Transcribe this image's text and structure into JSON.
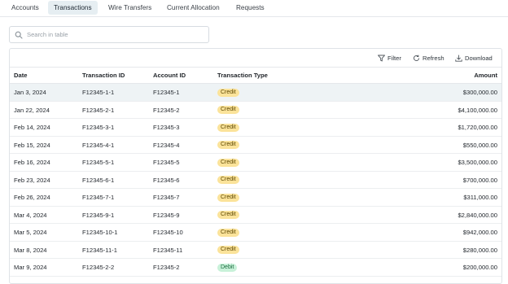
{
  "tabs": [
    {
      "label": "Accounts",
      "active": false
    },
    {
      "label": "Transactions",
      "active": true
    },
    {
      "label": "Wire Transfers",
      "active": false
    },
    {
      "label": "Current Allocation",
      "active": false
    },
    {
      "label": "Requests",
      "active": false
    }
  ],
  "search": {
    "placeholder": "Search in table",
    "icon": "search-icon"
  },
  "toolbar": {
    "filter_label": "Filter",
    "refresh_label": "Refresh",
    "download_label": "Download"
  },
  "columns": {
    "date": "Date",
    "transaction_id": "Transaction ID",
    "account_id": "Account ID",
    "transaction_type": "Transaction Type",
    "amount": "Amount"
  },
  "type_colors": {
    "Credit": {
      "bg": "#fbe39a",
      "fg": "#5c4700"
    },
    "Debit": {
      "bg": "#c8f1d9",
      "fg": "#1d6b3e"
    }
  },
  "rows": [
    {
      "date": "Jan 3, 2024",
      "transaction_id": "F12345-1-1",
      "account_id": "F12345-1",
      "type": "Credit",
      "amount": "$300,000.00"
    },
    {
      "date": "Jan 22, 2024",
      "transaction_id": "F12345-2-1",
      "account_id": "F12345-2",
      "type": "Credit",
      "amount": "$4,100,000.00"
    },
    {
      "date": "Feb 14, 2024",
      "transaction_id": "F12345-3-1",
      "account_id": "F12345-3",
      "type": "Credit",
      "amount": "$1,720,000.00"
    },
    {
      "date": "Feb 15, 2024",
      "transaction_id": "F12345-4-1",
      "account_id": "F12345-4",
      "type": "Credit",
      "amount": "$550,000.00"
    },
    {
      "date": "Feb 16, 2024",
      "transaction_id": "F12345-5-1",
      "account_id": "F12345-5",
      "type": "Credit",
      "amount": "$3,500,000.00"
    },
    {
      "date": "Feb 23, 2024",
      "transaction_id": "F12345-6-1",
      "account_id": "F12345-6",
      "type": "Credit",
      "amount": "$700,000.00"
    },
    {
      "date": "Feb 26, 2024",
      "transaction_id": "F12345-7-1",
      "account_id": "F12345-7",
      "type": "Credit",
      "amount": "$311,000.00"
    },
    {
      "date": "Mar 4, 2024",
      "transaction_id": "F12345-9-1",
      "account_id": "F12345-9",
      "type": "Credit",
      "amount": "$2,840,000.00"
    },
    {
      "date": "Mar 5, 2024",
      "transaction_id": "F12345-10-1",
      "account_id": "F12345-10",
      "type": "Credit",
      "amount": "$942,000.00"
    },
    {
      "date": "Mar 8, 2024",
      "transaction_id": "F12345-11-1",
      "account_id": "F12345-11",
      "type": "Credit",
      "amount": "$280,000.00"
    },
    {
      "date": "Mar 9, 2024",
      "transaction_id": "F12345-2-2",
      "account_id": "F12345-2",
      "type": "Debit",
      "amount": "$200,000.00"
    }
  ]
}
